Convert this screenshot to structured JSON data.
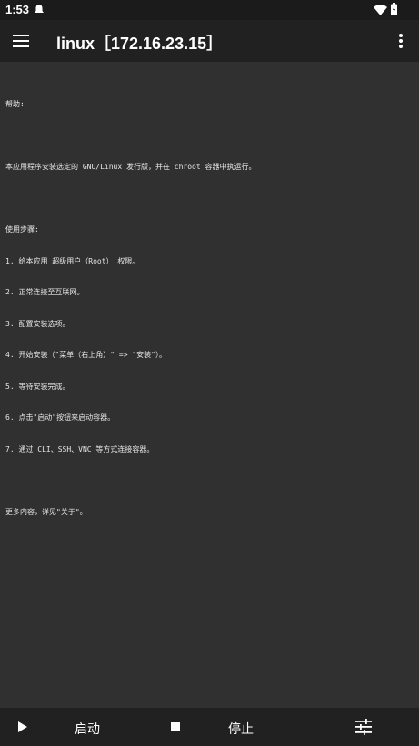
{
  "status_bar": {
    "time": "1:53",
    "icons": [
      "notification-icon",
      "wifi-icon",
      "battery-icon"
    ]
  },
  "app_bar": {
    "title": "linux［172.16.23.15］",
    "menu_icon": "hamburger-menu-icon",
    "more_icon": "more-vert-icon"
  },
  "log": {
    "help_heading": "帮助:",
    "intro": "本应用程序安装选定的 GNU/Linux 发行版，并在 chroot 容器中执运行。",
    "steps_heading": "使用步骤:",
    "steps": [
      "1. 给本应用 超级用户（Root） 权限。",
      "2. 正常连接至互联网。",
      "3. 配置安装选项。",
      "4. 开始安装（\"菜单（右上角）\" => \"安装\"）。",
      "5. 等待安装完成。",
      "6. 点击\"启动\"按钮来启动容器。",
      "7. 通过 CLI、SSH、VNC 等方式连接容器。"
    ],
    "more_info": "更多内容，详见\"关于\"。"
  },
  "bottom_bar": {
    "start_label": "启动",
    "stop_label": "停止",
    "start_icon": "play-icon",
    "stop_icon": "stop-icon",
    "settings_icon": "tune-icon"
  },
  "colors": {
    "background": "#303030",
    "app_bar": "#212121",
    "status_bar": "#1b1b1b",
    "text": "#e6e6e6"
  }
}
